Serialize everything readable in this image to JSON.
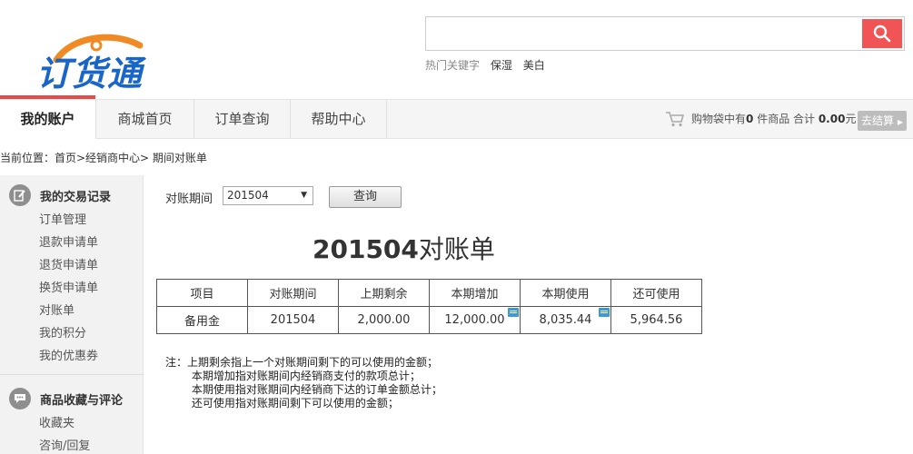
{
  "logo": {
    "text": "订货通"
  },
  "search": {
    "value": "",
    "placeholder": "",
    "hot_label": "热门关键字",
    "hot_keywords": [
      "保湿",
      "美白"
    ]
  },
  "nav": {
    "tabs": [
      {
        "label": "我的账户",
        "active": true
      },
      {
        "label": "商城首页",
        "active": false
      },
      {
        "label": "订单查询",
        "active": false
      },
      {
        "label": "帮助中心",
        "active": false
      }
    ],
    "cart": {
      "prefix": "购物袋中有",
      "count": "0",
      "mid": " 件商品 合计 ",
      "total": "0.00",
      "unit": "元",
      "checkout_label": "去结算"
    }
  },
  "breadcrumb": "当前位置：首页>经销商中心> 期间对账单",
  "sidebar": {
    "groups": [
      {
        "title": "我的交易记录",
        "icon": "edit-icon",
        "items": [
          "订单管理",
          "退款申请单",
          "退货申请单",
          "换货申请单",
          "对账单",
          "我的积分",
          "我的优惠券"
        ]
      },
      {
        "title": "商品收藏与评论",
        "icon": "chat-icon",
        "items": [
          "收藏夹",
          "咨询/回复"
        ]
      }
    ]
  },
  "filter": {
    "label": "对账期间",
    "selected": "201504",
    "query_label": "查询"
  },
  "statement": {
    "period": "201504",
    "title_suffix": "对账单",
    "headers": [
      "项目",
      "对账期间",
      "上期剩余",
      "本期增加",
      "本期使用",
      "还可使用"
    ],
    "row": [
      "备用金",
      "201504",
      "2,000.00",
      "12,000.00",
      "8,035.44",
      "5,964.56"
    ]
  },
  "notes": [
    "注：上期剩余指上一个对账期间剩下的可以使用的金额；",
    "    本期增加指对账期间内经销商支付的款项总计；",
    "    本期使用指对账期间内经销商下达的订单金额总计；",
    "    还可使用指对账期间剩下可以使用的金额；"
  ],
  "colors": {
    "brand_blue": "#1a66c8",
    "accent_red": "#e84a4a",
    "search_button": "#f05454",
    "detail_icon": "#3a9ad9"
  }
}
